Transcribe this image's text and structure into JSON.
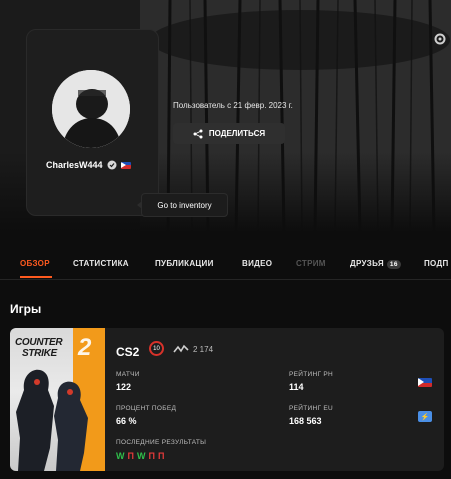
{
  "profile": {
    "username": "CharlesW444",
    "user_since": "Пользователь с 21 февр. 2023 г.",
    "share_label": "ПОДЕЛИТЬСЯ",
    "tooltip": "Go to inventory"
  },
  "tabs": [
    {
      "label": "ОБЗОР",
      "active": true
    },
    {
      "label": "СТАТИСТИКА"
    },
    {
      "label": "ПУБЛИКАЦИИ"
    },
    {
      "label": "ВИДЕО"
    },
    {
      "label": "СТРИМ",
      "muted": true
    },
    {
      "label": "ДРУЗЬЯ",
      "badge": "16"
    },
    {
      "label": "ПОДП"
    }
  ],
  "section": {
    "title": "Игры"
  },
  "game": {
    "cover_text_1": "COUNTER",
    "cover_text_2": "STRIKE",
    "cover_text_3": "2",
    "name": "CS2",
    "level": "10",
    "elo": "2 174",
    "stats": {
      "matches_label": "МАТЧИ",
      "matches_value": "122",
      "winrate_label": "ПРОЦЕНТ ПОБЕД",
      "winrate_value": "66 %",
      "recent_label": "ПОСЛЕДНИЕ РЕЗУЛЬТАТЫ",
      "rating_ph_label": "РЕЙТИНГ PH",
      "rating_ph_value": "114",
      "rating_eu_label": "РЕЙТИНГ EU",
      "rating_eu_value": "168 563"
    },
    "recent_results": [
      "W",
      "П",
      "W",
      "П",
      "П"
    ]
  },
  "colors": {
    "accent": "#ff5a1f",
    "win": "#2fbf4a",
    "loss": "#e23a3a",
    "level_ring": "#d8322a"
  }
}
